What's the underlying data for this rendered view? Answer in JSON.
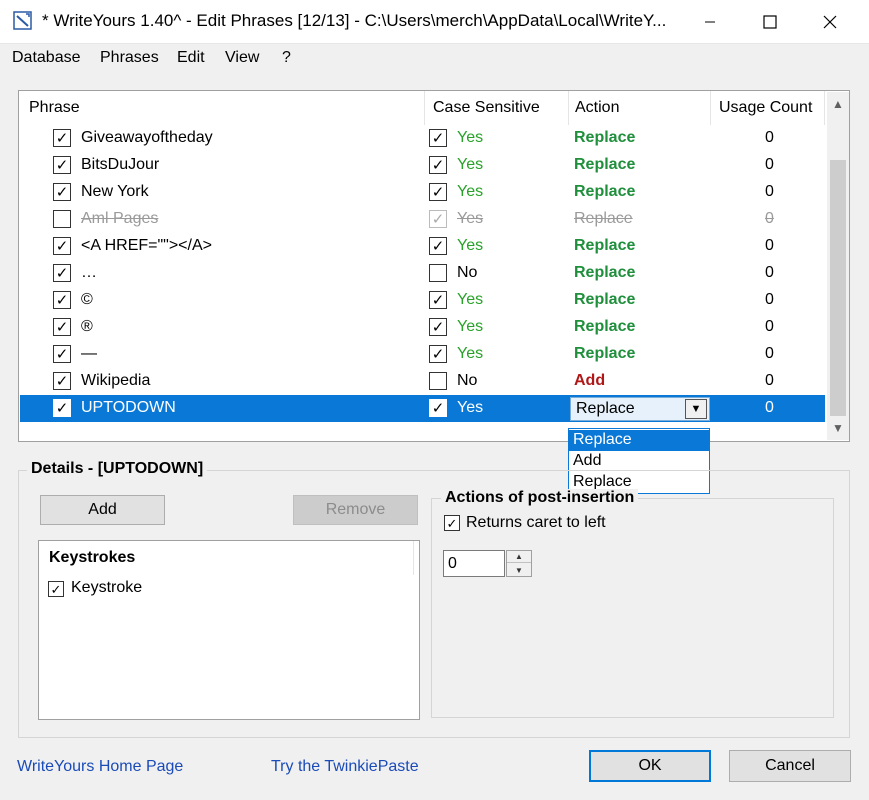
{
  "window": {
    "title": "* WriteYours 1.40^ - Edit Phrases [12/13] - C:\\Users\\merch\\AppData\\Local\\WriteY...",
    "minimize_icon": "minimize-icon",
    "maximize_icon": "maximize-icon",
    "close_icon": "close-icon"
  },
  "menu": [
    "Database",
    "Phrases",
    "Edit",
    "View",
    "?"
  ],
  "table": {
    "columns": [
      "Phrase",
      "Case Sensitive",
      "Action",
      "Usage Count"
    ],
    "rows": [
      {
        "phrase": "Giveawayoftheday",
        "enabled": true,
        "case": "Yes",
        "case_checked": true,
        "action": "Replace",
        "count": "0"
      },
      {
        "phrase": "BitsDuJour",
        "enabled": true,
        "case": "Yes",
        "case_checked": true,
        "action": "Replace",
        "count": "0"
      },
      {
        "phrase": "New York",
        "enabled": true,
        "case": "Yes",
        "case_checked": true,
        "action": "Replace",
        "count": "0"
      },
      {
        "phrase": "Aml Pages",
        "enabled": false,
        "case": "Yes",
        "case_checked": true,
        "action": "Replace",
        "count": "0"
      },
      {
        "phrase": "<A HREF=\"\"></A>",
        "enabled": true,
        "case": "Yes",
        "case_checked": true,
        "action": "Replace",
        "count": "0"
      },
      {
        "phrase": "…",
        "enabled": true,
        "case": "No",
        "case_checked": false,
        "action": "Replace",
        "count": "0"
      },
      {
        "phrase": "©",
        "enabled": true,
        "case": "Yes",
        "case_checked": true,
        "action": "Replace",
        "count": "0"
      },
      {
        "phrase": "®",
        "enabled": true,
        "case": "Yes",
        "case_checked": true,
        "action": "Replace",
        "count": "0"
      },
      {
        "phrase": "—",
        "enabled": true,
        "case": "Yes",
        "case_checked": true,
        "action": "Replace",
        "count": "0"
      },
      {
        "phrase": "Wikipedia",
        "enabled": true,
        "case": "No",
        "case_checked": false,
        "action": "Add",
        "count": "0"
      },
      {
        "phrase": "UPTODOWN",
        "enabled": true,
        "case": "Yes",
        "case_checked": true,
        "action": "Replace",
        "count": "0",
        "selected": true
      }
    ],
    "dropdown_options": [
      "Replace",
      "Add",
      "Replace"
    ],
    "dropdown_highlighted": 0
  },
  "details": {
    "title": "Details - [UPTODOWN]",
    "add_label": "Add",
    "remove_label": "Remove",
    "keystrokes_header": "Keystrokes",
    "keystroke_item": "Keystroke",
    "keystroke_checked": true
  },
  "post": {
    "title": "Actions of post-insertion",
    "returns_caret_label": "Returns caret to left",
    "returns_caret_checked": true,
    "spin_value": "0"
  },
  "footer": {
    "home_link": "WriteYours Home Page",
    "twinkie_link": "Try the TwinkiePaste",
    "ok_label": "OK",
    "cancel_label": "Cancel"
  },
  "colors": {
    "accent": "#0a78d7",
    "replace": "#1f8f3c",
    "add": "#b01818",
    "yes": "#28a228",
    "link": "#1a4bb8"
  }
}
